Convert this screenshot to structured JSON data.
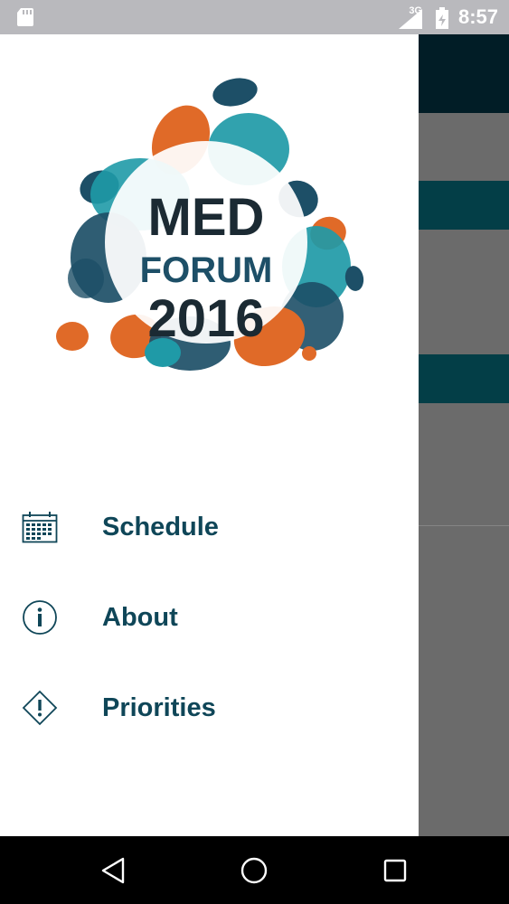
{
  "status_bar": {
    "network": "3G",
    "time": "8:57",
    "icons": [
      "sd-card-icon",
      "signal-icon",
      "battery-icon"
    ]
  },
  "logo": {
    "line1": "MED",
    "line2": "FORUM",
    "line3": "2016",
    "colors": {
      "teal": "#1f9aa7",
      "orange": "#e06a28",
      "navy": "#1d4f67",
      "text": "#1b2a33"
    }
  },
  "drawer": {
    "menu": [
      {
        "label": "Schedule",
        "icon": "calendar-icon"
      },
      {
        "label": "About",
        "icon": "info-icon"
      },
      {
        "label": "Priorities",
        "icon": "priority-icon"
      }
    ]
  },
  "theme": {
    "menu_text": "#0f4658",
    "toolbar": "#011d26",
    "band": "#033e47",
    "scrim": "#6b6b6b"
  },
  "nav_bar": {
    "buttons": [
      "back-icon",
      "home-icon",
      "recents-icon"
    ]
  }
}
